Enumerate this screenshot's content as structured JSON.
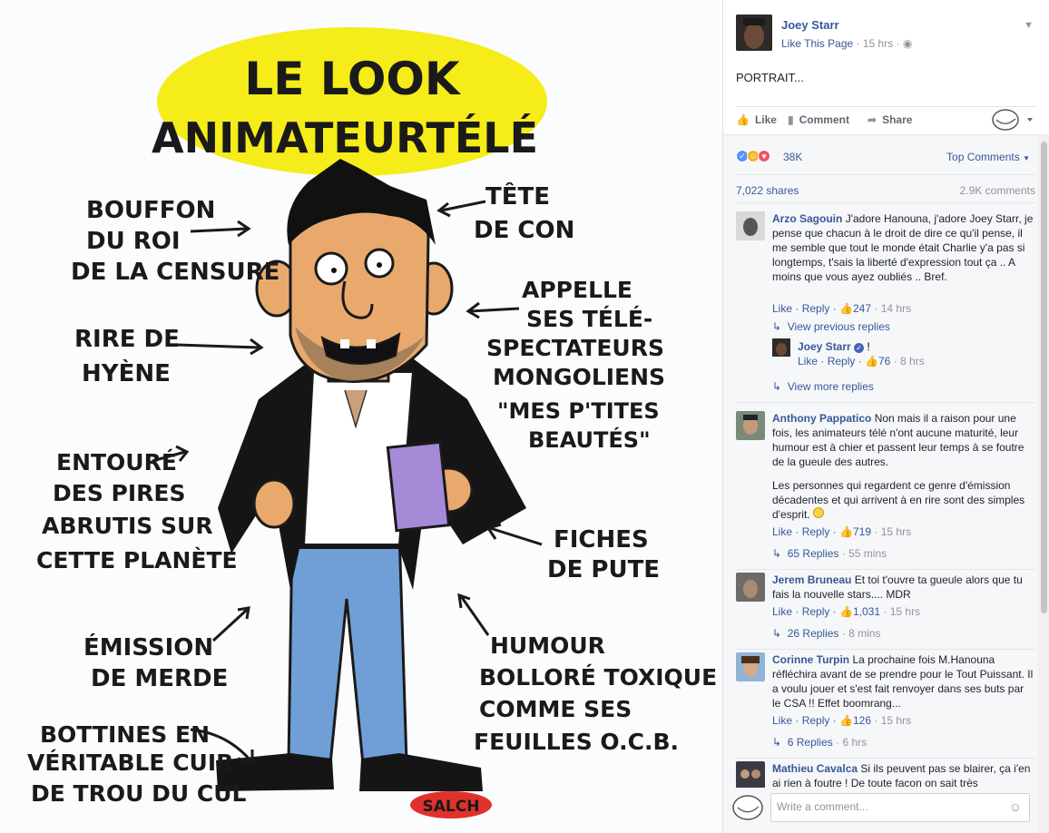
{
  "cartoon": {
    "title_line1": "LE LOOK",
    "title_line2": "ANIMATEURTÉLÉ",
    "labels": {
      "bouffon": [
        "BOUFFON",
        "DU ROI",
        "DE LA CENSURE"
      ],
      "tete": [
        "TÊTE",
        "DE CON"
      ],
      "rire": [
        "RIRE DE",
        "HYÈNE"
      ],
      "appelle": [
        "APPELLE",
        "SES TÉLÉ-",
        "SPECTATEURS",
        "MONGOLIENS",
        "\"MES P'TITES",
        "BEAUTÉS\""
      ],
      "entoure": [
        "ENTOURÉ",
        "DES PIRES",
        "ABRUTIS SUR",
        "CETTE PLANÈTE"
      ],
      "fiches": [
        "FICHES",
        "DE PUTE"
      ],
      "emission": [
        "ÉMISSION",
        "DE MERDE"
      ],
      "humour": [
        "HUMOUR",
        "BOLLORÉ TOXIQUE",
        "COMME SES",
        "FEUILLES O.C.B."
      ],
      "bottines": [
        "BOTTINES EN",
        "VÉRITABLE CUIR",
        "DE TROU DU CUL"
      ]
    },
    "signature": "SALCH"
  },
  "post": {
    "page_name": "Joey Starr",
    "like_page": "Like This Page",
    "time": "15 hrs",
    "globe_icon": "globe-icon",
    "text": "PORTRAIT..."
  },
  "actions": {
    "like": "Like",
    "comment": "Comment",
    "share": "Share"
  },
  "reactions": {
    "count": "38K",
    "top_comments": "Top Comments",
    "colors": {
      "like": "#5890ff",
      "haha": "#f7b125",
      "love": "#f25268"
    }
  },
  "stats": {
    "shares": "7,022 shares",
    "comments": "2.9K comments"
  },
  "comments": [
    {
      "name": "Arzo Sagouin",
      "text": "J'adore Hanouna, j'adore Joey Starr, je pense que chacun à le droit de dire ce qu'il pense, il me semble que tout le monde était Charlie y'a pas si longtemps, t'sais la liberté d'expression tout ça .. A moins que vous ayez oubliés .. Bref.",
      "like": "Like",
      "reply": "Reply",
      "likes": "247",
      "time": "14 hrs",
      "view_previous": "View previous replies",
      "nested": {
        "name": "Joey Starr",
        "text": "!",
        "like": "Like",
        "reply": "Reply",
        "likes": "76",
        "time": "8 hrs"
      },
      "view_more": "View more replies"
    },
    {
      "name": "Anthony Pappatico",
      "text": "Non mais il a raison pour une fois, les animateurs télé n'ont aucune maturité, leur humour est à chier et passent leur temps à se foutre de la gueule des autres.",
      "text2": "Les personnes qui regardent ce genre d'émission décadentes et qui arrivent à en rire sont des simples d'esprit.",
      "like": "Like",
      "reply": "Reply",
      "likes": "719",
      "time": "15 hrs",
      "replies": "65 Replies",
      "replies_time": "55 mins"
    },
    {
      "name": "Jerem Bruneau",
      "text": "Et toi t'ouvre ta gueule alors que tu fais la nouvelle stars.... MDR",
      "like": "Like",
      "reply": "Reply",
      "likes": "1,031",
      "time": "15 hrs",
      "replies": "26 Replies",
      "replies_time": "8 mins"
    },
    {
      "name": "Corinne Turpin",
      "text": "La prochaine fois M.Hanouna réfléchira avant de se prendre pour le Tout Puissant. Il a voulu jouer et s'est fait renvoyer dans ses buts par le CSA !! Effet boomrang...",
      "like": "Like",
      "reply": "Reply",
      "likes": "126",
      "time": "15 hrs",
      "replies": "6 Replies",
      "replies_time": "6 hrs"
    },
    {
      "name": "Mathieu Cavalca",
      "text": "Si ils peuvent pas se blairer, ça i'en ai rien à foutre ! De toute facon on sait très"
    }
  ],
  "composer": {
    "placeholder": "Write a comment..."
  }
}
